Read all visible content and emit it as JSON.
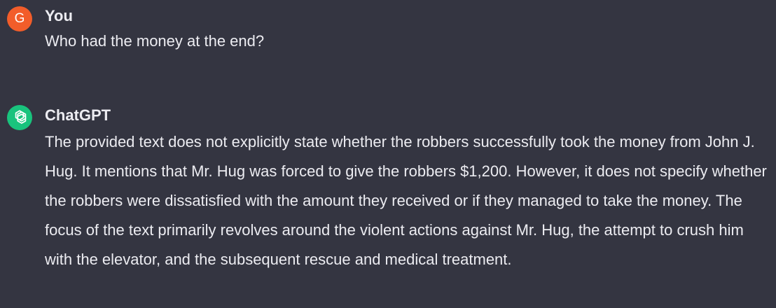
{
  "conversation": {
    "user": {
      "avatar_letter": "G",
      "avatar_color": "#f25d2a",
      "author": "You",
      "message": "Who had the money at the end?"
    },
    "assistant": {
      "avatar_icon": "chatgpt-logo-icon",
      "avatar_color": "#19c37d",
      "author": "ChatGPT",
      "message": "The provided text does not explicitly state whether the robbers successfully took the money from John J. Hug. It mentions that Mr. Hug was forced to give the robbers $1,200. However, it does not specify whether the robbers were dissatisfied with the amount they received or if they managed to take the money. The focus of the text primarily revolves around the violent actions against Mr. Hug, the attempt to crush him with the elevator, and the subsequent rescue and medical treatment."
    }
  },
  "colors": {
    "background": "#343541",
    "text": "#ececf1"
  }
}
